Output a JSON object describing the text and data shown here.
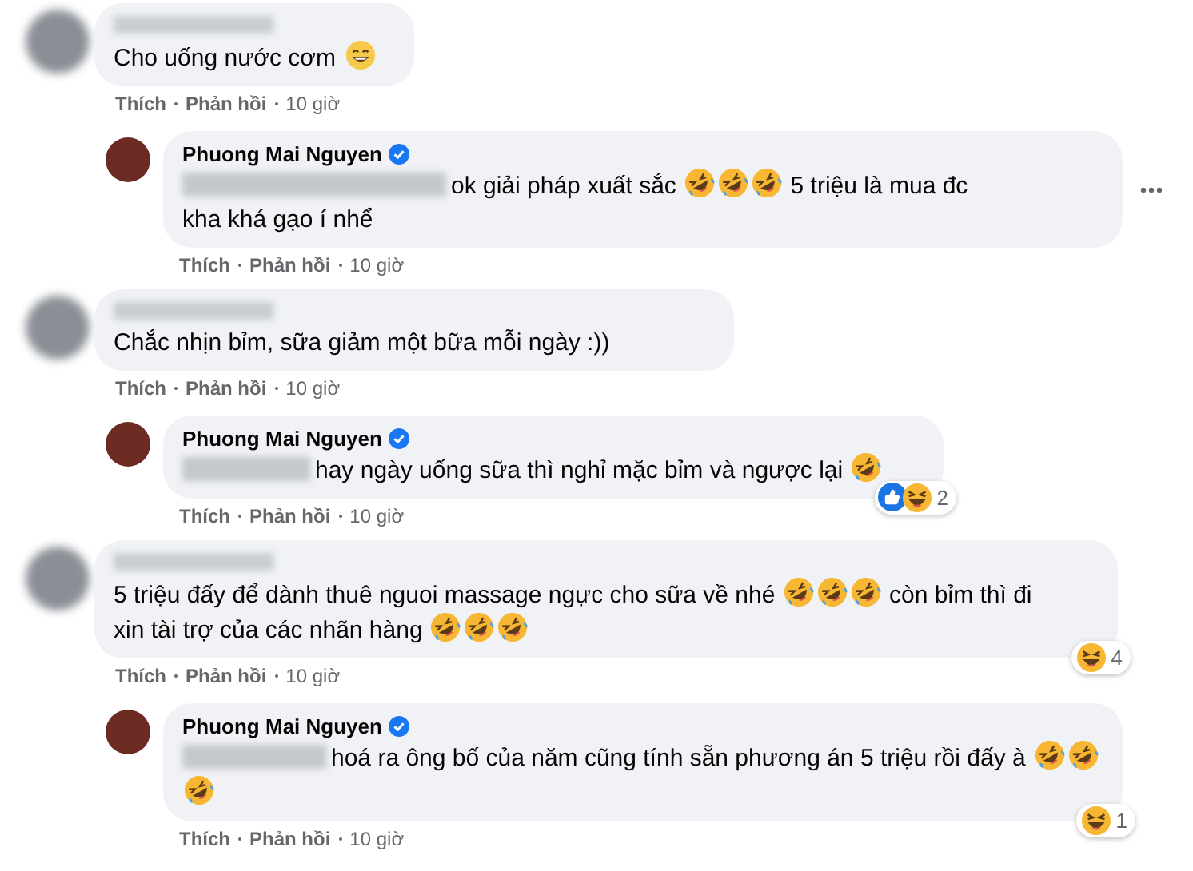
{
  "comments": [
    {
      "kind": "comment",
      "name_blurred": true,
      "body": [
        {
          "kind": "text",
          "text": "Cho uống nước cơm"
        },
        {
          "kind": "grin_emoji"
        }
      ],
      "actions": [
        "Thích",
        "Phản hồi",
        "10 giờ"
      ]
    },
    {
      "kind": "reply",
      "author": "Phuong Mai Nguyen",
      "verified": true,
      "mention_blurred": true,
      "more_button": true,
      "body": [
        {
          "kind": "text",
          "text": "ok giải pháp xuất sắc"
        },
        {
          "kind": "rofl_emoji"
        },
        {
          "kind": "rofl_emoji"
        },
        {
          "kind": "rofl_emoji"
        },
        {
          "kind": "text",
          "text": "5 triệu là mua đc kha khá gạo í nhể"
        }
      ],
      "actions": [
        "Thích",
        "Phản hồi",
        "10 giờ"
      ]
    },
    {
      "kind": "comment",
      "name_blurred": true,
      "body": [
        {
          "kind": "text",
          "text": "Chắc nhịn bỉm, sữa giảm một bữa mỗi ngày :))"
        }
      ],
      "actions": [
        "Thích",
        "Phản hồi",
        "10 giờ"
      ]
    },
    {
      "kind": "reply",
      "author": "Phuong Mai Nguyen",
      "verified": true,
      "mention_blurred": true,
      "more_button": false,
      "body": [
        {
          "kind": "text",
          "text": "hay ngày uống sữa thì nghỉ mặc bỉm và ngược lại"
        },
        {
          "kind": "rofl_emoji"
        }
      ],
      "reactions": {
        "types": [
          {
            "kind": "like"
          },
          {
            "kind": "haha"
          }
        ],
        "count": "2"
      },
      "actions": [
        "Thích",
        "Phản hồi",
        "10 giờ"
      ]
    },
    {
      "kind": "comment",
      "name_blurred": true,
      "body": [
        {
          "kind": "text",
          "text": "5 triệu đấy để dành thuê nguoi massage ngực cho sữa về nhé"
        },
        {
          "kind": "rofl_emoji"
        },
        {
          "kind": "rofl_emoji"
        },
        {
          "kind": "rofl_emoji"
        },
        {
          "kind": "text",
          "text": "còn bỉm thì đi xin tài trợ của các nhãn hàng"
        },
        {
          "kind": "rofl_emoji"
        },
        {
          "kind": "rofl_emoji"
        },
        {
          "kind": "rofl_emoji"
        }
      ],
      "reactions": {
        "types": [
          {
            "kind": "haha"
          }
        ],
        "count": "4"
      },
      "actions": [
        "Thích",
        "Phản hồi",
        "10 giờ"
      ]
    },
    {
      "kind": "reply",
      "author": "Phuong Mai Nguyen",
      "verified": true,
      "mention_blurred": true,
      "more_button": false,
      "body": [
        {
          "kind": "text",
          "text": "hoá ra ông bố của năm cũng tính sẵn phương án 5 triệu rồi đấy à"
        },
        {
          "kind": "rofl_emoji"
        },
        {
          "kind": "rofl_emoji"
        },
        {
          "kind": "rofl_emoji"
        }
      ],
      "reactions": {
        "types": [
          {
            "kind": "haha"
          }
        ],
        "count": "1"
      },
      "actions": [
        "Thích",
        "Phản hồi",
        "10 giờ"
      ]
    }
  ]
}
